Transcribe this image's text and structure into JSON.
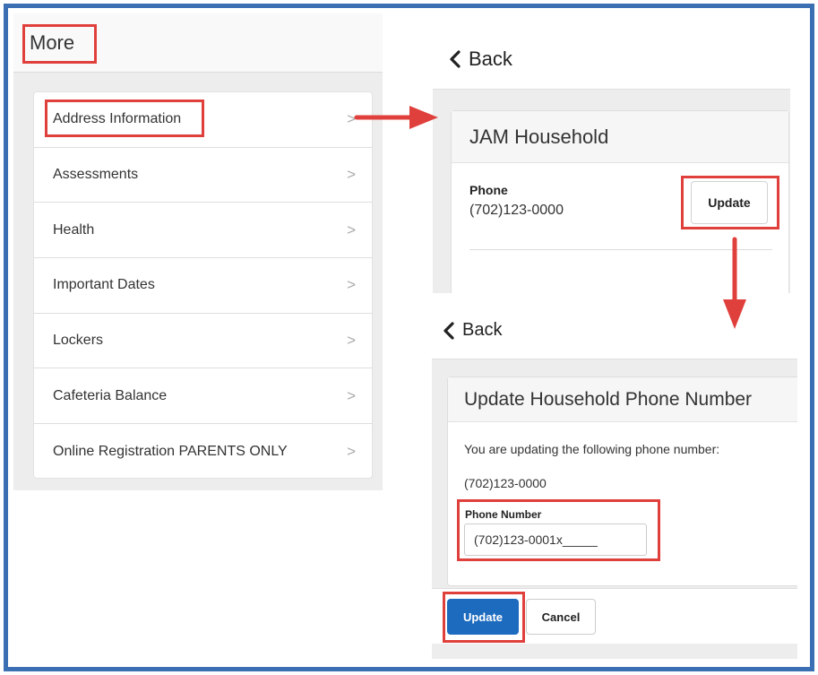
{
  "more_panel": {
    "title": "More",
    "items": [
      {
        "label": "Address Information"
      },
      {
        "label": "Assessments"
      },
      {
        "label": "Health"
      },
      {
        "label": "Important Dates"
      },
      {
        "label": "Lockers"
      },
      {
        "label": "Cafeteria Balance"
      },
      {
        "label": "Online Registration PARENTS ONLY"
      }
    ],
    "chevron": ">"
  },
  "household_panel": {
    "back_label": "Back",
    "title": "JAM Household",
    "phone_label": "Phone",
    "phone_value": "(702)123-0000",
    "update_label": "Update"
  },
  "update_phone_panel": {
    "back_label": "Back",
    "title": "Update Household Phone Number",
    "description": "You are updating the following phone number:",
    "current_number": "(702)123-0000",
    "phone_number_label": "Phone Number",
    "phone_number_value": "(702)123-0001x_____",
    "update_label": "Update",
    "cancel_label": "Cancel"
  },
  "colors": {
    "frame_border": "#3a6fb4",
    "highlight": "#e0403c",
    "primary_button": "#1d6bbf"
  },
  "icons": {
    "back": "chevron-left-icon",
    "item": "chevron-right-icon",
    "flow": "arrow-icon"
  }
}
